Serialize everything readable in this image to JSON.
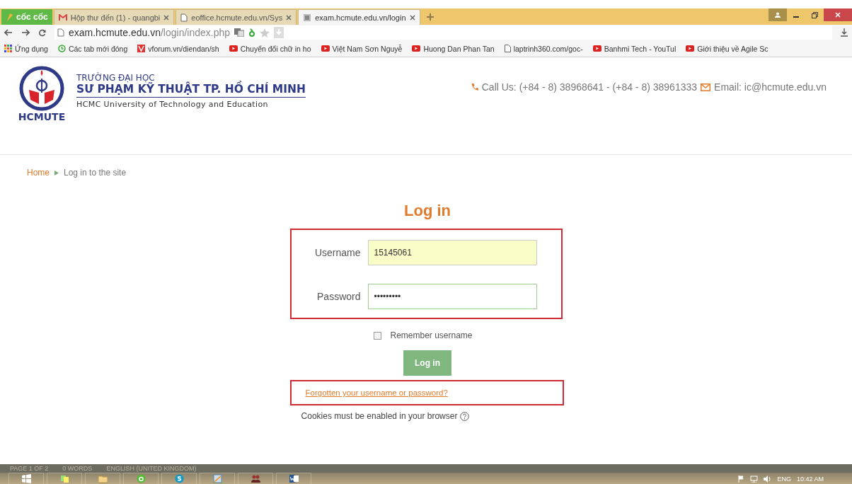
{
  "browser": {
    "brand": "cốc cốc",
    "tabs": [
      {
        "label": "Hộp thư đến (1) - quangbi",
        "kind": "mail",
        "selected": false
      },
      {
        "label": "eoffice.hcmute.edu.vn/Sys",
        "kind": "page",
        "selected": false
      },
      {
        "label": "exam.hcmute.edu.vn/login",
        "kind": "site",
        "selected": true
      }
    ],
    "address": {
      "host": "exam.hcmute.edu.vn",
      "path": "/login/index.php"
    },
    "bookmarks": [
      {
        "label": "Ứng dụng",
        "kind": "apps"
      },
      {
        "label": "Các tab mới đóng",
        "kind": "history"
      },
      {
        "label": "vforum.vn/diendan/sh",
        "kind": "vforum"
      },
      {
        "label": "Chuyển đổi chữ in ho",
        "kind": "video"
      },
      {
        "label": "Việt Nam Sơn Nguyễ",
        "kind": "video"
      },
      {
        "label": "Huong Dan Phan Tan",
        "kind": "video"
      },
      {
        "label": "laptrinh360.com/goc-",
        "kind": "page"
      },
      {
        "label": "Banhmi Tech - YouTul",
        "kind": "video"
      },
      {
        "label": "Giới thiệu về Agile Sc",
        "kind": "video"
      }
    ]
  },
  "page": {
    "header": {
      "logo_text": "HCMUTE",
      "school_line1": "TRƯỜNG ĐẠI HỌC",
      "school_line2": "SƯ PHẠM KỸ THUẬT TP. HỒ CHÍ MINH",
      "school_en": "HCMC University of Technology and Education",
      "phone": "Call Us: (+84 - 8) 38968641 - (+84 - 8) 38961333",
      "email": "Email: ic@hcmute.edu.vn"
    },
    "breadcrumb": [
      {
        "label": "Home",
        "kind": "link"
      },
      {
        "label": "Log in to the site",
        "kind": "current"
      }
    ],
    "login": {
      "title": "Log in",
      "fields": [
        {
          "label": "Username",
          "value": "15145061",
          "kind": "text",
          "autofilled": true
        },
        {
          "label": "Password",
          "value": "•••••••••",
          "kind": "password",
          "autofilled": false
        }
      ],
      "remember": {
        "label": "Remember username",
        "checked": false
      },
      "button": "Log in",
      "forgot_link": "Forgotten your username or password?",
      "cookies_note": "Cookies must be enabled in your browser"
    }
  },
  "taskbar": {
    "status_items": [
      "PAGE 1 OF 2",
      "0 WORDS",
      "ENGLISH (UNITED KINGDOM)"
    ],
    "apps": [
      {
        "kind": "start"
      },
      {
        "kind": "notes"
      },
      {
        "kind": "folder"
      },
      {
        "kind": "browser"
      },
      {
        "kind": "skype"
      },
      {
        "kind": "paint"
      },
      {
        "kind": "people"
      },
      {
        "kind": "word"
      }
    ],
    "language": "ENG",
    "time": "10:42 AM"
  }
}
